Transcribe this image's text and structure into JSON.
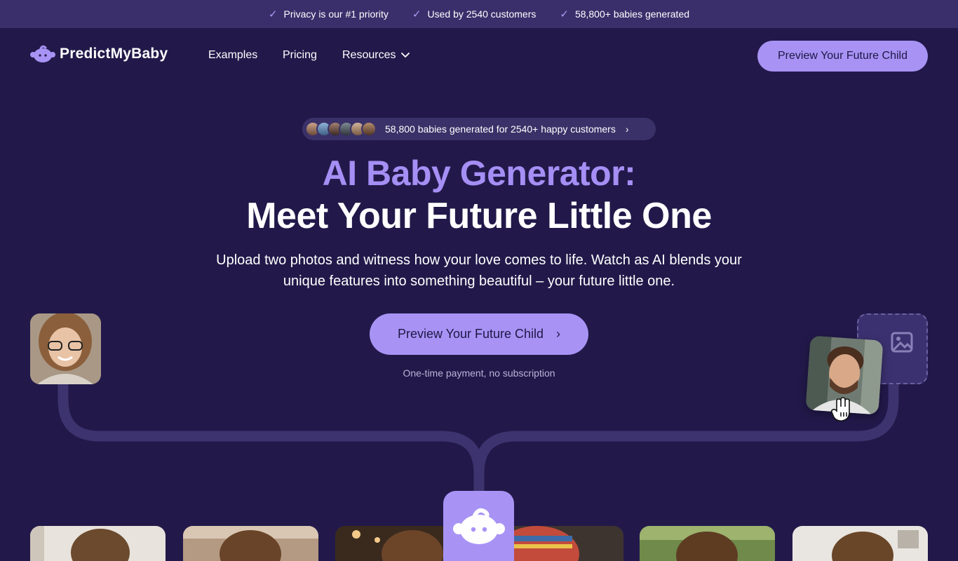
{
  "topbar": {
    "items": [
      {
        "icon": "check-icon",
        "label": "Privacy is our #1 priority"
      },
      {
        "icon": "check-icon",
        "label": "Used by 2540 customers"
      },
      {
        "icon": "check-icon",
        "label": "58,800+ babies generated"
      }
    ]
  },
  "nav": {
    "logo_text": "PredictMyBaby",
    "links": [
      "Examples",
      "Pricing",
      "Resources"
    ],
    "cta_label": "Preview Your Future Child"
  },
  "hero": {
    "pill_text": "58,800 babies generated for 2540+ happy customers",
    "title_line1": "AI Baby Generator:",
    "title_line2": "Meet Your Future Little One",
    "subtitle": "Upload two photos and witness how your love comes to life. Watch as AI blends your unique features into something beautiful – your future little one.",
    "cta_label": "Preview Your Future Child",
    "note": "One-time payment, no subscription"
  },
  "colors": {
    "background": "#22194a",
    "topbar": "#3a2f6b",
    "accent": "#a893f5",
    "title_accent": "#a58ff5"
  }
}
